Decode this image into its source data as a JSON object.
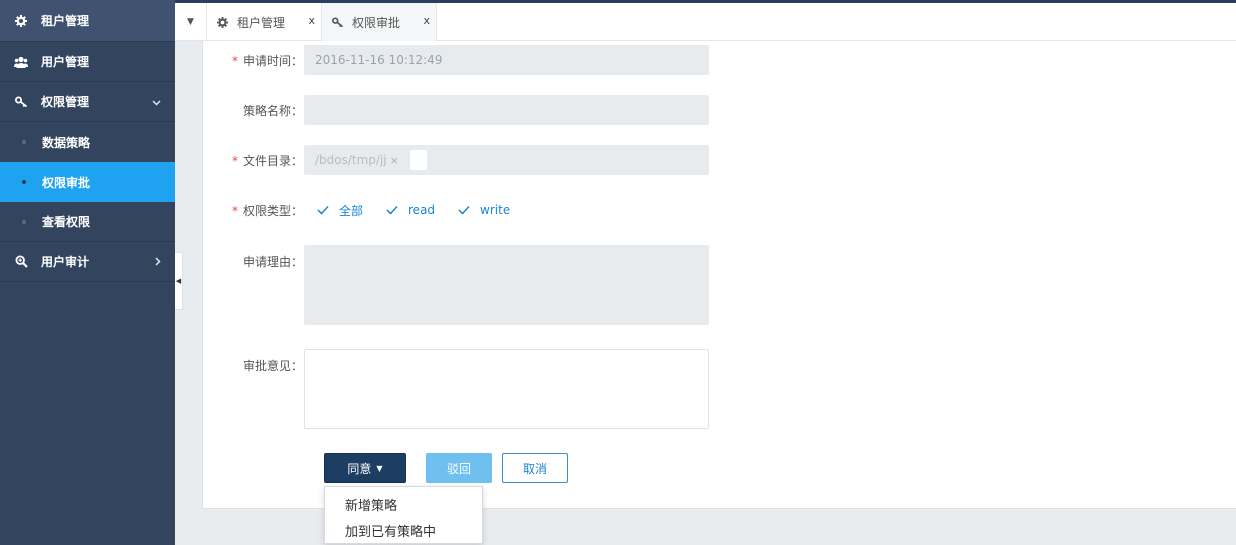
{
  "sidebar": {
    "items": [
      {
        "label": "租户管理",
        "icon": "gear-icon"
      },
      {
        "label": "用户管理",
        "icon": "users-icon"
      },
      {
        "label": "权限管理",
        "icon": "key-icon",
        "expanded": true
      },
      {
        "label": "用户审计",
        "icon": "zoom-icon"
      }
    ],
    "subitems": [
      {
        "label": "数据策略"
      },
      {
        "label": "权限审批",
        "active": true
      },
      {
        "label": "查看权限"
      }
    ]
  },
  "tabs": [
    {
      "label": "租户管理",
      "icon": "gear-icon",
      "close": "x"
    },
    {
      "label": "权限审批",
      "icon": "key-icon",
      "close": "x",
      "active": true
    }
  ],
  "form": {
    "apply_time": {
      "label": "申请时间：",
      "value": "2016-11-16 10:12:49",
      "required": true
    },
    "policy_name": {
      "label": "策略名称：",
      "value": ""
    },
    "file_dir": {
      "label": "文件目录：",
      "chip": "/bdos/tmp/jj",
      "chip_close": "×",
      "required": true
    },
    "perm_type": {
      "label": "权限类型：",
      "required": true,
      "options": [
        {
          "label": "全部",
          "checked": true
        },
        {
          "label": "read",
          "checked": true
        },
        {
          "label": "write",
          "checked": true
        }
      ]
    },
    "reason": {
      "label": "申请理由：",
      "value": ""
    },
    "opinion": {
      "label": "审批意见：",
      "value": ""
    },
    "required_mark": "*"
  },
  "buttons": {
    "agree": "同意",
    "reject": "驳回",
    "cancel": "取消"
  },
  "dropdown": {
    "items": [
      "新增策略",
      "加到已有策略中"
    ]
  },
  "colors": {
    "sidebar_bg": "#33445f",
    "active": "#1fa3f0",
    "primary": "#1d3e63",
    "link": "#1a86d0",
    "required": "#e04b4b"
  }
}
